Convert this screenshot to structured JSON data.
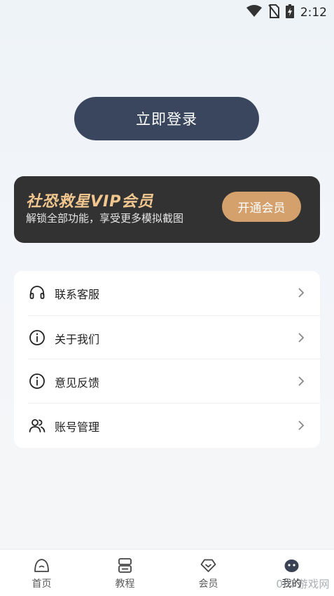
{
  "status_bar": {
    "time": "2:12",
    "icons": [
      "wifi-icon",
      "no-sim-icon",
      "battery-charging-icon"
    ]
  },
  "login": {
    "label": "立即登录"
  },
  "vip": {
    "title": "社恐救星VIP会员",
    "subtitle": "解锁全部功能，享受更多模拟截图",
    "button": "开通会员"
  },
  "menu": {
    "items": [
      {
        "label": "联系客服",
        "icon": "headset-icon"
      },
      {
        "label": "关于我们",
        "icon": "info-icon"
      },
      {
        "label": "意见反馈",
        "icon": "info-icon"
      },
      {
        "label": "账号管理",
        "icon": "users-icon"
      }
    ]
  },
  "tabs": {
    "items": [
      {
        "label": "首页",
        "icon": "home-icon"
      },
      {
        "label": "教程",
        "icon": "tutorial-icon"
      },
      {
        "label": "会员",
        "icon": "vip-icon"
      },
      {
        "label": "我的",
        "icon": "profile-icon",
        "active": true
      }
    ]
  },
  "watermark": "007游戏网",
  "colors": {
    "login_button": "#39465e",
    "vip_card": "#323233",
    "vip_title": "#f1c78f",
    "vip_button": "#d4a06c"
  }
}
